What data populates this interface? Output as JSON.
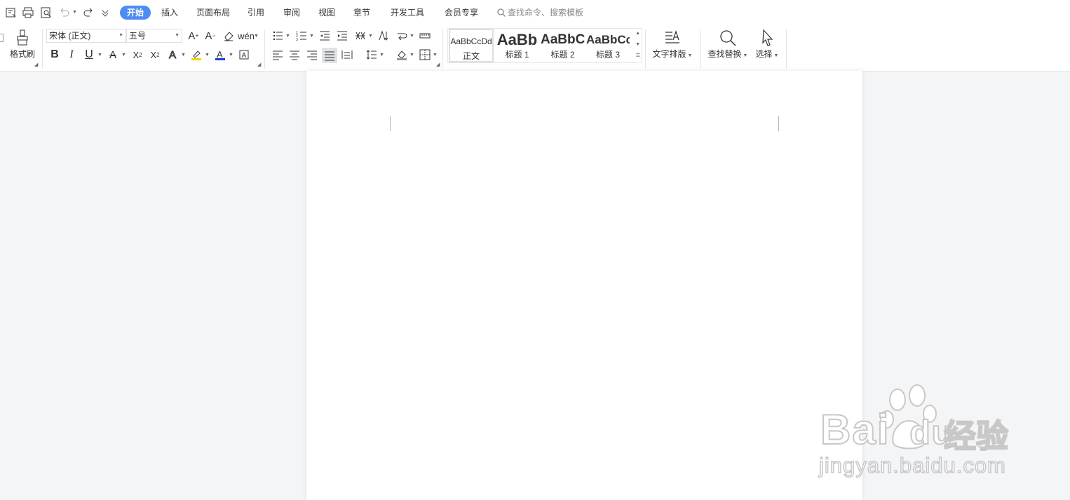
{
  "tabs": [
    "开始",
    "插入",
    "页面布局",
    "引用",
    "审阅",
    "视图",
    "章节",
    "开发工具",
    "会员专享"
  ],
  "search": {
    "placeholder": "查找命令、搜索模板"
  },
  "ribbon": {
    "format_painter": "格式刷",
    "font_name": "宋体 (正文)",
    "font_size": "五号",
    "styles": [
      {
        "preview": "AaBbCcDd",
        "label": "正文"
      },
      {
        "preview": "AaBb",
        "label": "标题 1"
      },
      {
        "preview": "AaBbC",
        "label": "标题 2"
      },
      {
        "preview": "AaBbCc",
        "label": "标题 3"
      }
    ],
    "text_layout": "文字排版",
    "find_replace": "查找替换",
    "select": "选择"
  },
  "watermark": {
    "brand": "Bai",
    "brand_suffix": "du",
    "tagline": "经验",
    "url": "jingyan.baidu.com"
  },
  "colors": {
    "accent": "#4f8cf0",
    "highlight": "#f5d400",
    "font_color": "#1e3fd8"
  }
}
